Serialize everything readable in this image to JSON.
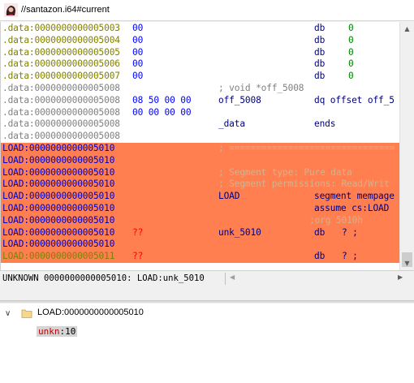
{
  "title_bar": {
    "title": "//santazon.i64#current",
    "icon": "user-avatar-icon"
  },
  "disassembly": {
    "lines": [
      {
        "addr": ".data:0000000000005003",
        "bytes": "00",
        "mnem": "db",
        "operand": "0",
        "addr_color": "data"
      },
      {
        "addr": ".data:0000000000005004",
        "bytes": "00",
        "mnem": "db",
        "operand": "0",
        "addr_color": "data"
      },
      {
        "addr": ".data:0000000000005005",
        "bytes": "00",
        "mnem": "db",
        "operand": "0",
        "addr_color": "data"
      },
      {
        "addr": ".data:0000000000005006",
        "bytes": "00",
        "mnem": "db",
        "operand": "0",
        "addr_color": "data"
      },
      {
        "addr": ".data:0000000000005007",
        "bytes": "00",
        "mnem": "db",
        "operand": "0",
        "addr_color": "data"
      },
      {
        "addr": ".data:0000000000005008",
        "comment": "; void *off_5008",
        "addr_color": "gray"
      },
      {
        "addr": ".data:0000000000005008",
        "bytes": "08 50 00 00",
        "label": "off_5008",
        "mnem": "dq offset off_5",
        "addr_color": "gray"
      },
      {
        "addr": ".data:0000000000005008",
        "bytes": "00 00 00 00",
        "addr_color": "gray"
      },
      {
        "addr": ".data:0000000000005008",
        "label": "_data",
        "mnem": "ends",
        "addr_color": "gray"
      },
      {
        "addr": ".data:0000000000005008",
        "addr_color": "gray"
      },
      {
        "addr": "LOAD:0000000000005010",
        "comment": "; ===============================",
        "addr_color": "load",
        "hl": true
      },
      {
        "addr": "LOAD:0000000000005010",
        "addr_color": "load",
        "hl": true
      },
      {
        "addr": "LOAD:0000000000005010",
        "comment": "; Segment type: Pure data",
        "addr_color": "load",
        "hl": true
      },
      {
        "addr": "LOAD:0000000000005010",
        "comment": "; Segment permissions: Read/Writ",
        "addr_color": "load",
        "hl": true
      },
      {
        "addr": "LOAD:0000000000005010",
        "label": "LOAD",
        "mnem": "segment mempage",
        "addr_color": "load",
        "hl": true
      },
      {
        "addr": "LOAD:0000000000005010",
        "mnem": "assume cs:LOAD",
        "addr_color": "load",
        "hl": true
      },
      {
        "addr": "LOAD:0000000000005010",
        "comment2": ";org 5010h",
        "addr_color": "load",
        "hl": true
      },
      {
        "addr": "LOAD:0000000000005010",
        "bytes": "??",
        "label": "unk_5010",
        "mnem": "db",
        "operand": "? ;",
        "addr_color": "load",
        "hl": true
      },
      {
        "addr": "LOAD:0000000000005010",
        "addr_color": "load",
        "hl": true
      },
      {
        "addr": "LOAD:0000000000005011",
        "bytes": "??",
        "mnem": "db",
        "operand": "? ;",
        "addr_color": "load-y",
        "hl": true
      },
      {
        "addr": "",
        "bytes": "",
        "addr_color": "load",
        "hl": false,
        "partial": true
      }
    ]
  },
  "status_bar": {
    "text": "UNKNOWN 0000000000005010: LOAD:unk_5010"
  },
  "struct_view": {
    "node_label": "LOAD:0000000000005010",
    "field_name": "unkn",
    "field_value": ":10"
  },
  "colors": {
    "highlight": "#ff7f50",
    "address_data": "#808000",
    "address_load": "#0000c0",
    "bytes": "#0000ff"
  }
}
